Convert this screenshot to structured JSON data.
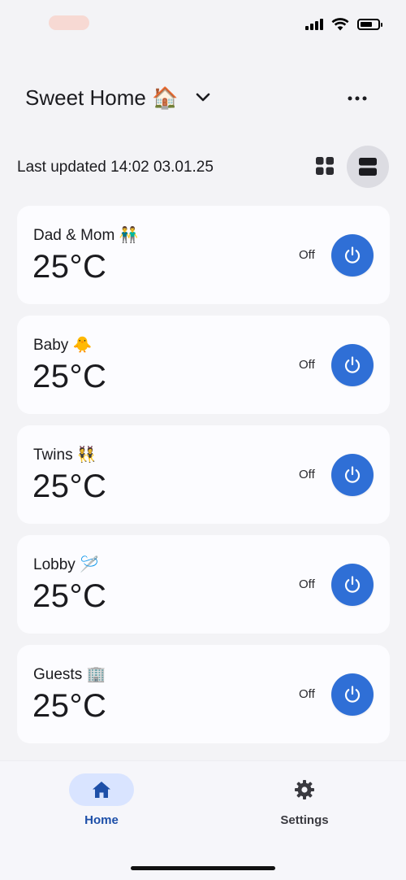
{
  "header": {
    "home_title": "Sweet Home 🏠",
    "chevron_icon": "chevron-down-icon",
    "more_icon": "more-horizontal-icon"
  },
  "toolbar": {
    "last_updated": "Last updated 14:02 03.01.25",
    "grid_view_icon": "grid-view-icon",
    "list_view_icon": "list-view-icon",
    "active_view": "list"
  },
  "rooms": [
    {
      "name": "Dad & Mom 👬",
      "temperature": "25°C",
      "state": "Off"
    },
    {
      "name": "Baby 🐥",
      "temperature": "25°C",
      "state": "Off"
    },
    {
      "name": "Twins 👯",
      "temperature": "25°C",
      "state": "Off"
    },
    {
      "name": "Lobby 🪡",
      "temperature": "25°C",
      "state": "Off"
    },
    {
      "name": "Guests 🏢",
      "temperature": "25°C",
      "state": "Off"
    }
  ],
  "nav": {
    "home_label": "Home",
    "settings_label": "Settings",
    "active": "home"
  },
  "colors": {
    "accent": "#2f6fd6",
    "nav_active_bg": "#d9e4ff",
    "nav_active_text": "#1d4fa8",
    "card_bg": "#fcfcff",
    "page_bg": "#f3f3f6"
  }
}
